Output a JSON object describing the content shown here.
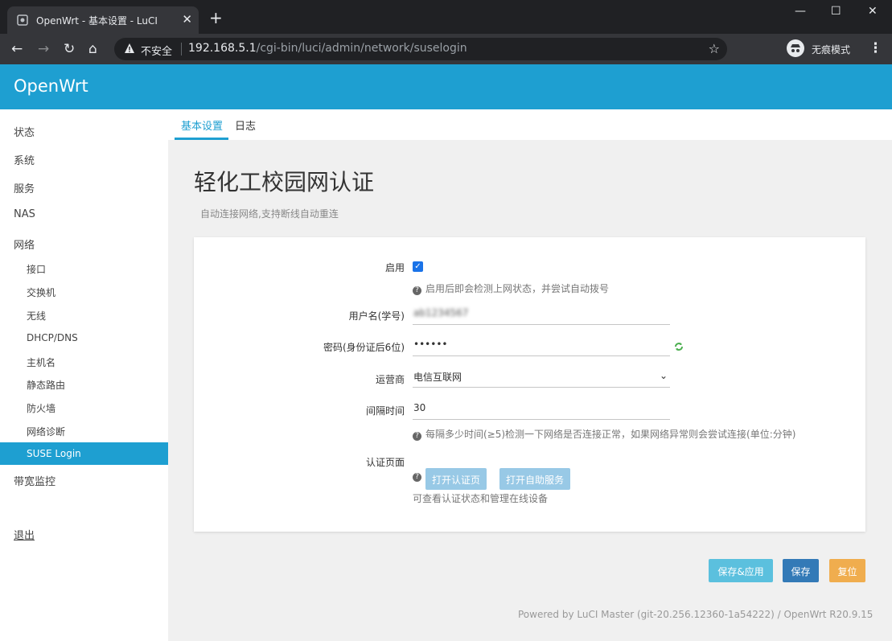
{
  "browser": {
    "tab_title": "OpenWrt - 基本设置 - LuCI",
    "insecure_label": "不安全",
    "url_host": "192.168.5.1",
    "url_path": "/cgi-bin/luci/admin/network/suselogin",
    "incognito_label": "无痕模式"
  },
  "header": {
    "brand": "OpenWrt"
  },
  "sidebar": {
    "items": [
      "状态",
      "系统",
      "服务",
      "NAS",
      "网络"
    ],
    "network_children": [
      "接口",
      "交换机",
      "无线",
      "DHCP/DNS",
      "主机名",
      "静态路由",
      "防火墙",
      "网络诊断",
      "SUSE Login"
    ],
    "bandwidth": "带宽监控",
    "logout": "退出"
  },
  "tabs": [
    "基本设置",
    "日志"
  ],
  "page": {
    "title": "轻化工校园网认证",
    "description": "自动连接网络,支持断线自动重连"
  },
  "form": {
    "enable": {
      "label": "启用",
      "checked": true,
      "help": "启用后即会检测上网状态，并尝试自动拨号"
    },
    "username": {
      "label": "用户名(学号)",
      "value": "ab1234567"
    },
    "password": {
      "label": "密码(身份证后6位)",
      "value": "••••••"
    },
    "isp": {
      "label": "运营商",
      "value": "电信互联网"
    },
    "interval": {
      "label": "间隔时间",
      "value": "30",
      "help": "每隔多少时间(≥5)检测一下网络是否连接正常，如果网络异常则会尝试连接(单位:分钟)"
    },
    "auth_page": {
      "label": "认证页面",
      "btn_open_auth": "打开认证页",
      "btn_self_service": "打开自助服务",
      "help": "可查看认证状态和管理在线设备"
    }
  },
  "actions": {
    "save_apply": "保存&应用",
    "save": "保存",
    "reset": "复位"
  },
  "footer": "Powered by LuCI Master (git-20.256.12360-1a54222) / OpenWrt R20.9.15",
  "colors": {
    "accent": "#1e9fd1",
    "save_apply": "#5bc0de",
    "save": "#337ab7",
    "reset": "#f0ad4e"
  }
}
